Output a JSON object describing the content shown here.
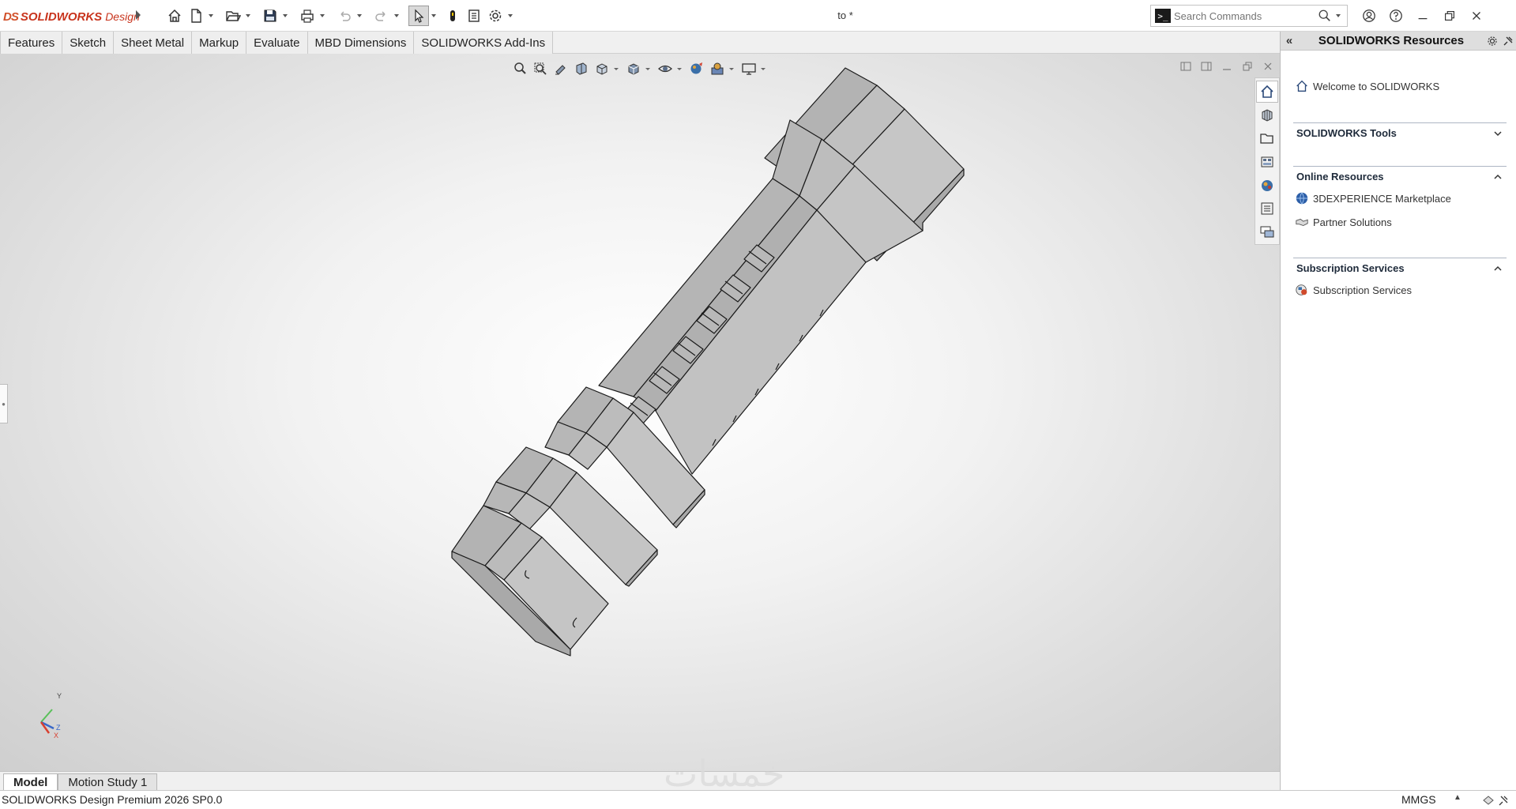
{
  "app": {
    "logo_mark": "DS",
    "logo_brand": "SOLIDWORKS",
    "logo_product": "Design",
    "document_title": "to *"
  },
  "quick_access": {
    "icons": [
      "home-icon",
      "new-document-icon",
      "open-folder-icon",
      "save-icon",
      "print-icon",
      "undo-icon",
      "redo-icon",
      "select-cursor-icon",
      "rebuild-icon",
      "file-properties-icon",
      "options-gear-icon"
    ]
  },
  "search": {
    "placeholder": "Search Commands"
  },
  "command_tabs": [
    {
      "label": "Features"
    },
    {
      "label": "Sketch"
    },
    {
      "label": "Sheet Metal"
    },
    {
      "label": "Markup"
    },
    {
      "label": "Evaluate"
    },
    {
      "label": "MBD Dimensions"
    },
    {
      "label": "SOLIDWORKS Add-Ins"
    }
  ],
  "heads_up_toolbar": {
    "icons": [
      "zoom-to-fit-icon",
      "zoom-to-area-icon",
      "previous-view-icon",
      "section-view-icon",
      "view-orientation-icon",
      "display-style-icon",
      "hide-show-items-icon",
      "edit-appearance-icon",
      "apply-scene-icon",
      "view-settings-icon"
    ]
  },
  "triad": {
    "y_label": "Y",
    "z_label": "Z",
    "x_label": "X"
  },
  "resources": {
    "title": "SOLIDWORKS Resources",
    "welcome": "Welcome to SOLIDWORKS",
    "sections": [
      {
        "title": "SOLIDWORKS Tools",
        "expanded": false,
        "items": []
      },
      {
        "title": "Online Resources",
        "expanded": true,
        "items": [
          {
            "label": "3DEXPERIENCE Marketplace",
            "icon": "globe-icon"
          },
          {
            "label": "Partner Solutions",
            "icon": "handshake-icon"
          }
        ]
      },
      {
        "title": "Subscription Services",
        "expanded": true,
        "items": [
          {
            "label": "Subscription Services",
            "icon": "subscription-icon"
          }
        ]
      }
    ]
  },
  "taskpane_tabs": [
    "resources-home-icon",
    "design-library-icon",
    "file-explorer-icon",
    "view-palette-icon",
    "appearances-icon",
    "custom-properties-icon",
    "forum-icon"
  ],
  "bottom_tabs": [
    {
      "label": "Model",
      "active": true
    },
    {
      "label": "Motion Study 1",
      "active": false
    }
  ],
  "watermark": "خمسات",
  "status": {
    "product": "SOLIDWORKS Design Premium 2026 SP0.0",
    "units": "MMGS"
  },
  "colors": {
    "accent": "#c8341d",
    "model_face": "#bfbfbf",
    "model_edge": "#1a1a1a"
  }
}
